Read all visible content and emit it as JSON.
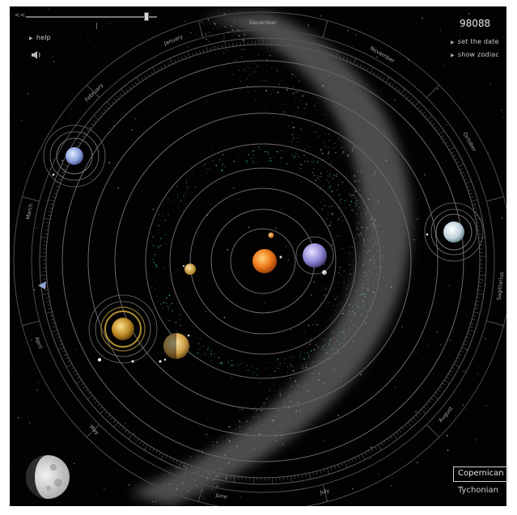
{
  "header": {
    "date_readout": "98088",
    "set_date_label": "set the date",
    "show_zodiac_label": "show zodiac"
  },
  "controls": {
    "help_label": "help",
    "rewind_glyph": "<<",
    "slider_tick_label": "0",
    "slider_position": 0.92,
    "sound_icon": "speaker-icon"
  },
  "view_modes": {
    "active": "Copernican",
    "inactive": "Tychonian"
  },
  "months": [
    {
      "label": "December",
      "angle": 0
    },
    {
      "label": "November",
      "angle": 30
    },
    {
      "label": "October",
      "angle": 60
    },
    {
      "label": "Sagittarius",
      "angle": 96
    },
    {
      "label": "August",
      "angle": 130
    },
    {
      "label": "July",
      "angle": 165
    },
    {
      "label": "June",
      "angle": 190
    },
    {
      "label": "May",
      "angle": 225
    },
    {
      "label": "April",
      "angle": 250
    },
    {
      "label": "March",
      "angle": 282
    },
    {
      "label": "February",
      "angle": 315
    },
    {
      "label": "January",
      "angle": 338
    }
  ],
  "colors": {
    "space": "#020202",
    "orbit": "#6a6a6a",
    "ring": "#4d4d4d",
    "milky_way": "#8a8a8a",
    "sun": "#e77a1c",
    "asteroid": "#3fb7b7",
    "ui_text": "#c9c9c9"
  },
  "bodies": [
    {
      "name": "sun",
      "icon": "sun-icon"
    },
    {
      "name": "mercury",
      "icon": "mercury-icon"
    },
    {
      "name": "venus",
      "icon": "venus-icon"
    },
    {
      "name": "earth",
      "icon": "earth-icon"
    },
    {
      "name": "mars",
      "icon": "mars-icon"
    },
    {
      "name": "jupiter",
      "icon": "jupiter-icon"
    },
    {
      "name": "saturn",
      "icon": "saturn-icon"
    },
    {
      "name": "uranus",
      "icon": "uranus-icon"
    },
    {
      "name": "neptune",
      "icon": "neptune-icon"
    },
    {
      "name": "comet-marker",
      "icon": "triangle-marker-icon"
    },
    {
      "name": "moon-phase",
      "icon": "moon-phase-icon"
    }
  ]
}
